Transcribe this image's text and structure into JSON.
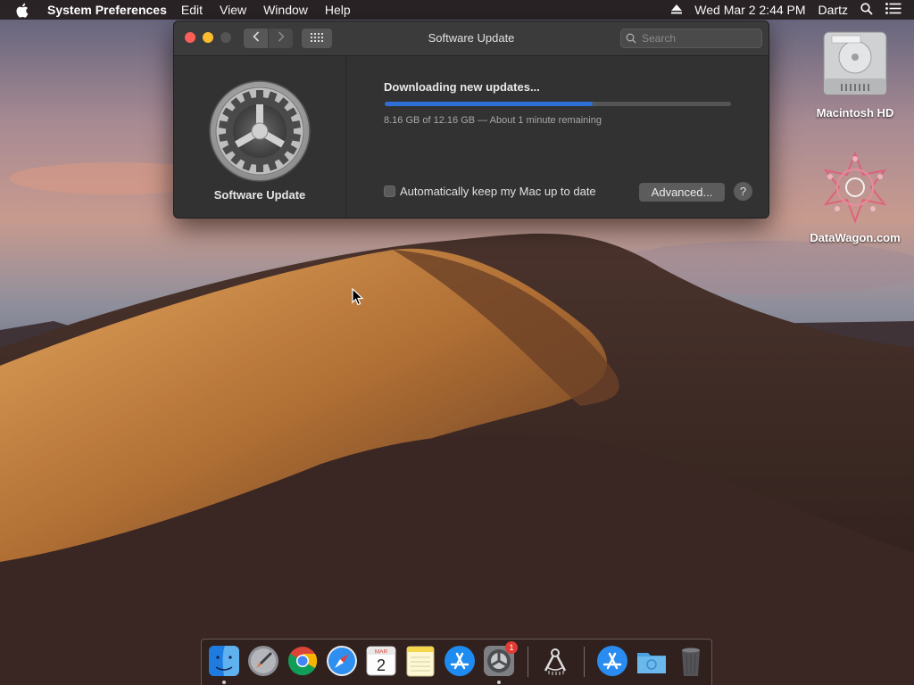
{
  "menubar": {
    "app_name": "System Preferences",
    "items": [
      "Edit",
      "View",
      "Window",
      "Help"
    ],
    "clock": "Wed Mar 2  2:44 PM",
    "user": "Dartz"
  },
  "window": {
    "title": "Software Update",
    "search_placeholder": "Search",
    "sidebar_label": "Software Update",
    "status_title": "Downloading new updates...",
    "progress_fraction": 0.6,
    "progress_text": "8.16 GB of 12.16 GB — About 1 minute remaining",
    "auto_update_label": "Automatically keep my Mac up to date",
    "auto_update_checked": false,
    "advanced_button": "Advanced...",
    "help_button": "?"
  },
  "desktop": {
    "icons": [
      {
        "label": "Macintosh HD",
        "icon": "hard-drive-icon"
      },
      {
        "label": "DataWagon.com",
        "icon": "datawagon-logo-icon"
      }
    ]
  },
  "dock": {
    "items": [
      {
        "name": "finder",
        "icon": "finder-icon",
        "running": true
      },
      {
        "name": "launchpad",
        "icon": "launchpad-icon",
        "running": false
      },
      {
        "name": "chrome",
        "icon": "chrome-icon",
        "running": false
      },
      {
        "name": "safari",
        "icon": "safari-icon",
        "running": false
      },
      {
        "name": "calendar",
        "icon": "calendar-icon",
        "running": false,
        "month": "MAR",
        "day": "2"
      },
      {
        "name": "notes",
        "icon": "notes-icon",
        "running": false
      },
      {
        "name": "app-store",
        "icon": "app-store-icon",
        "running": false
      },
      {
        "name": "system-preferences",
        "icon": "system-preferences-icon",
        "running": true,
        "badge": "1"
      },
      {
        "name": "utility",
        "icon": "gauge-tool-icon",
        "running": false
      },
      {
        "name": "applications",
        "icon": "applications-folder-icon",
        "running": false
      },
      {
        "name": "downloads",
        "icon": "downloads-folder-icon",
        "running": false
      },
      {
        "name": "trash",
        "icon": "trash-icon",
        "running": false
      }
    ]
  },
  "colors": {
    "accent": "#2e6fd6",
    "close": "#fc5f57",
    "minimize": "#fdbc2e",
    "badge": "#e03a32"
  }
}
